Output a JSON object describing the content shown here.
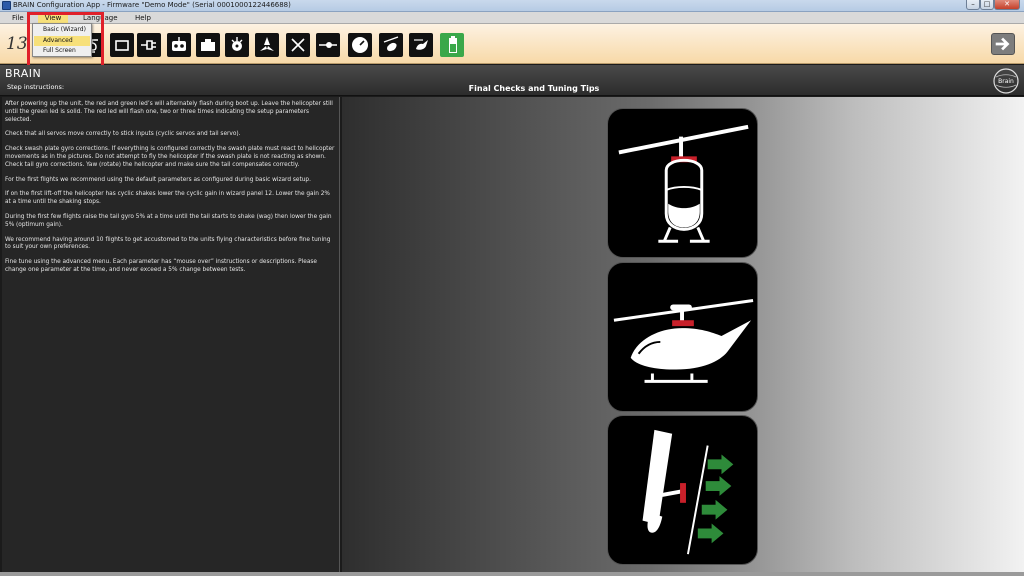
{
  "window": {
    "title": "BRAIN Configuration App - Firmware \"Demo Mode\" (Serial 0001000122446688)",
    "minimize_glyph": "–",
    "maximize_glyph": "□",
    "close_glyph": "✕"
  },
  "menu": {
    "file": "File",
    "view": "View",
    "language": "Language",
    "help": "Help"
  },
  "view_menu": {
    "basic": "Basic (Wizard)",
    "advanced": "Advanced",
    "full_screen": "Full Screen"
  },
  "toolbar": {
    "panel_number": "13",
    "buttons": [
      "helicopter-icon",
      "receiver-icon",
      "connector-icon",
      "transmitter-icon",
      "servo-icon",
      "swash-icon",
      "rotor-icon",
      "tail-icon",
      "tail-servo-icon",
      "gauge-icon",
      "heli-tilt-icon",
      "heli-side-icon",
      "battery-icon"
    ],
    "active_button": "battery-icon"
  },
  "header": {
    "brand": "BRAIN",
    "step_label": "Step instructions:",
    "page_title": "Final Checks and Tuning Tips",
    "logo_text": "Brain"
  },
  "instructions": [
    "After powering up the unit, the red and green led’s will alternately flash during boot up. Leave the helicopter still until the green led is solid. The red led will flash one, two or three times indicating the setup parameters selected.",
    "Check that all servos move correctly to stick inputs (cyclic servos and tail servo).",
    "Check swash plate gyro corrections. If everything is configured correctly the swash plate must react to helicopter movements as in the pictures. Do not attempt to fly the helicopter if the swash plate is not reacting as shown.\nCheck tail gyro corrections. Yaw (rotate) the helicopter and make sure the tail compensates correctly.",
    "For the first flights we recommend using the default parameters as configured during basic wizard setup.",
    "If on the first lift-off the helicopter has cyclic shakes lower the cyclic gain in wizard panel 12. Lower the gain 2% at a time until the shaking stops.",
    "During the first few flights raise the tail gyro 5% at a time until the tail starts to shake (wag) then lower the gain 5% (optimum gain).",
    "We recommend having around 10 flights to get accustomed to the units flying characteristics before fine tuning to suit your own preferences.",
    "Fine tune using the advanced menu. Each parameter has “mouse over” instructions or descriptions. Please change one parameter at the time, and never exceed a 5% change between tests."
  ],
  "colors": {
    "accent_red": "#c8202a",
    "accent_green": "#2e8b3a",
    "menu_highlight": "#f7e07a",
    "active_button": "#3aa84a"
  }
}
